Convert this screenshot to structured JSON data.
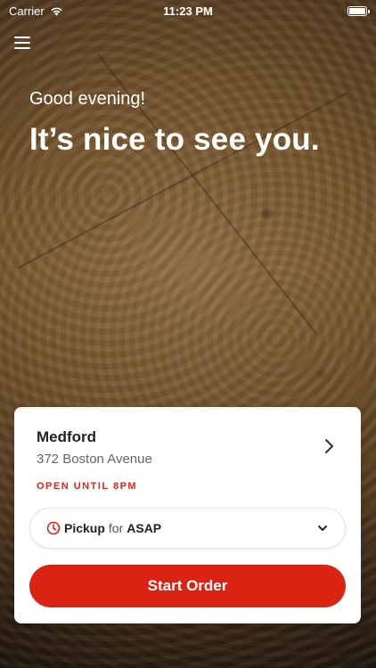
{
  "status_bar": {
    "carrier": "Carrier",
    "time": "11:23 PM"
  },
  "hero": {
    "greeting": "Good evening!",
    "headline": "It’s nice to see you."
  },
  "store": {
    "name": "Medford",
    "address": "372 Boston Avenue",
    "hours_status": "OPEN UNTIL 8PM"
  },
  "order_mode": {
    "mode": "Pickup",
    "connector": "for",
    "time": "ASAP"
  },
  "actions": {
    "start_order_label": "Start Order"
  },
  "icons": {
    "menu": "hamburger-menu-icon",
    "wifi": "wifi-icon",
    "battery": "battery-icon",
    "chevron_right": "chevron-right-icon",
    "clock": "clock-icon",
    "chevron_down": "chevron-down-icon"
  },
  "colors": {
    "accent": "#d92414",
    "status_text": "#d42a1a"
  }
}
